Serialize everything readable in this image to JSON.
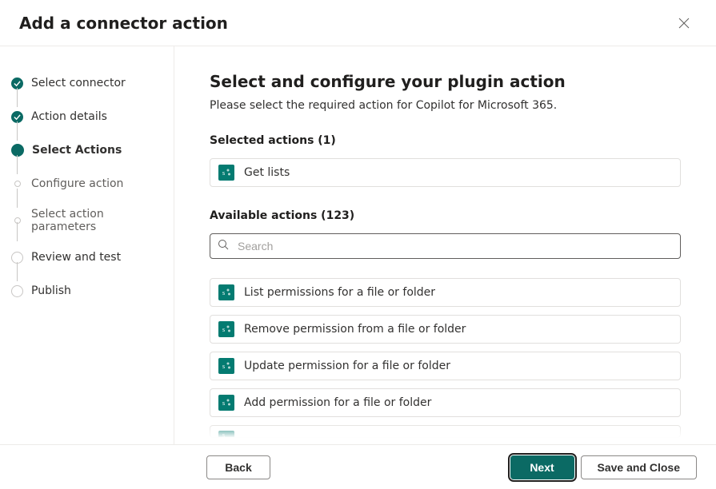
{
  "header": {
    "title": "Add a connector action"
  },
  "steps": [
    {
      "label": "Select connector",
      "state": "done"
    },
    {
      "label": "Action details",
      "state": "done"
    },
    {
      "label": "Select Actions",
      "state": "current"
    },
    {
      "label": "Configure action",
      "state": "sub"
    },
    {
      "label": "Select action parameters",
      "state": "sub"
    },
    {
      "label": "Review and test",
      "state": "future"
    },
    {
      "label": "Publish",
      "state": "future"
    }
  ],
  "main": {
    "heading": "Select and configure your plugin action",
    "description": "Please select the required action for Copilot for Microsoft 365.",
    "selected_label": "Selected actions (1)",
    "available_label": "Available actions (123)",
    "search_placeholder": "Search"
  },
  "selected_actions": [
    {
      "title": "Get lists"
    }
  ],
  "available_actions": [
    {
      "title": "List permissions for a file or folder"
    },
    {
      "title": "Remove permission from a file or folder"
    },
    {
      "title": "Update permission for a file or folder"
    },
    {
      "title": "Add permission for a file or folder"
    }
  ],
  "footer": {
    "back": "Back",
    "next": "Next",
    "save_close": "Save and Close"
  },
  "icon_color": "#047b71"
}
